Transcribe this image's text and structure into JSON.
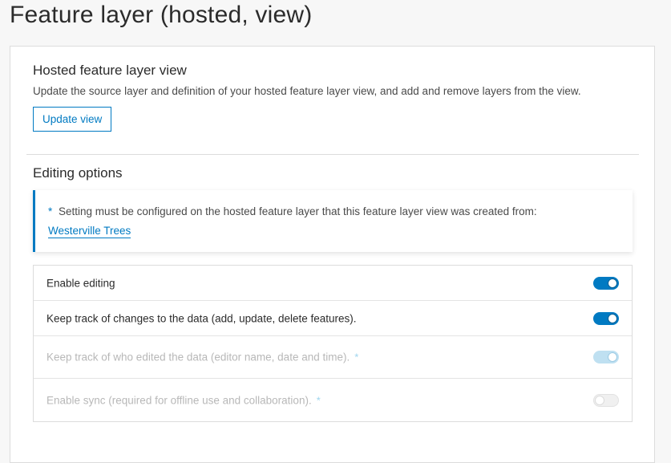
{
  "page": {
    "title": "Feature layer (hosted, view)"
  },
  "view_section": {
    "heading": "Hosted feature layer view",
    "description": "Update the source layer and definition of your hosted feature layer view, and add and remove layers from the view.",
    "update_button_label": "Update view"
  },
  "editing_section": {
    "heading": "Editing options",
    "notice": {
      "asterisk": "*",
      "text": "Setting must be configured on the hosted feature layer that this feature layer view was created from:",
      "link_text": "Westerville Trees"
    },
    "options": [
      {
        "label": "Enable editing",
        "enabled": true,
        "checked": true,
        "requires_source": false
      },
      {
        "label": "Keep track of changes to the data (add, update, delete features).",
        "enabled": true,
        "checked": true,
        "requires_source": false
      },
      {
        "label": "Keep track of who edited the data (editor name, date and time).",
        "enabled": false,
        "checked": true,
        "requires_source": true,
        "star": "*"
      },
      {
        "label": "Enable sync (required for offline use and collaboration).",
        "enabled": false,
        "checked": false,
        "requires_source": true,
        "star": "*"
      }
    ]
  },
  "colors": {
    "accent": "#007ac2",
    "page_background": "#f7f7f7",
    "panel_background": "#ffffff",
    "disabled_text": "#b8b8b8"
  }
}
